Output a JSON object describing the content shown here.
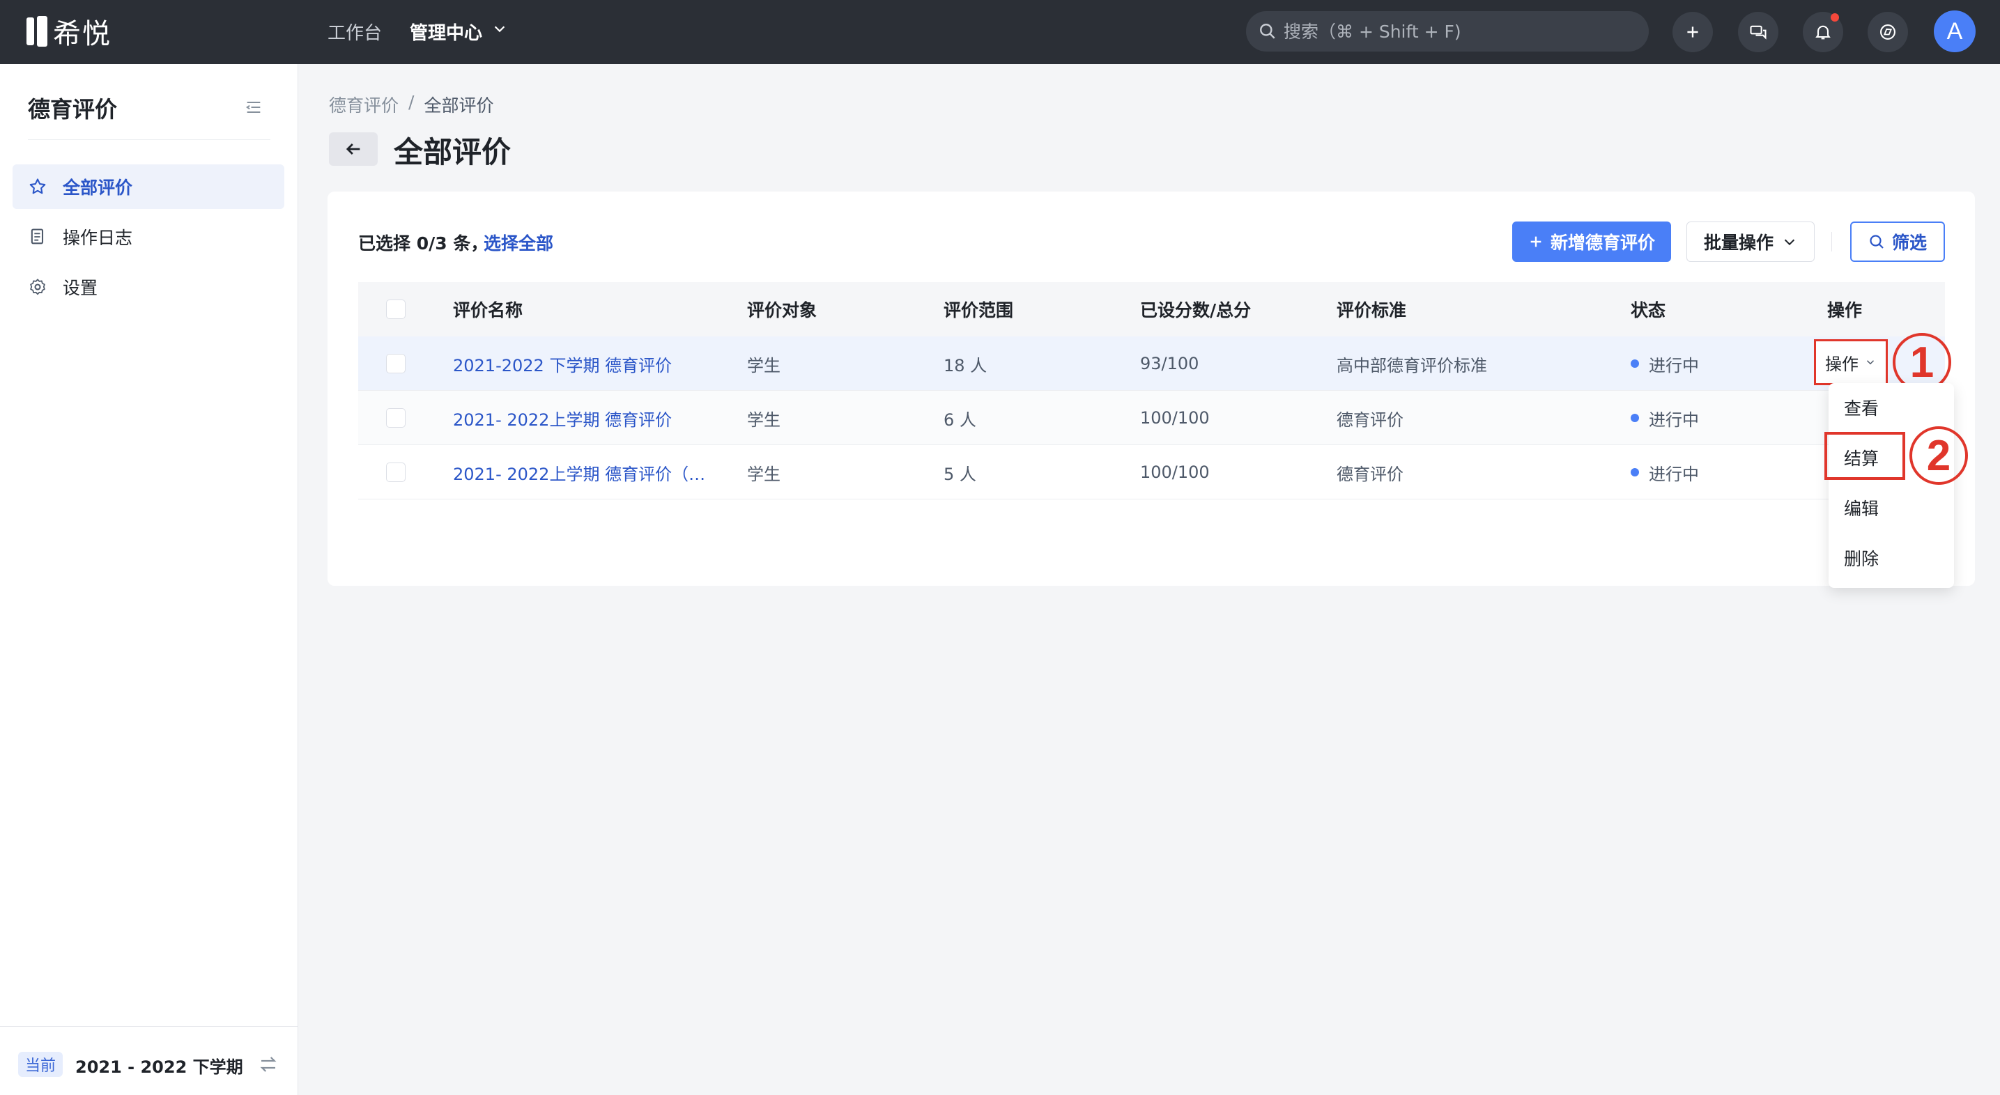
{
  "app": {
    "logo_text": "希悦",
    "nav": {
      "workspace": "工作台",
      "admin": "管理中心"
    },
    "search_placeholder": "搜索（⌘ + Shift + F)",
    "avatar_letter": "A"
  },
  "sidebar": {
    "title": "德育评价",
    "items": [
      {
        "label": "全部评价",
        "icon": "star-icon",
        "active": true
      },
      {
        "label": "操作日志",
        "icon": "document-icon",
        "active": false
      },
      {
        "label": "设置",
        "icon": "gear-icon",
        "active": false
      }
    ],
    "footer": {
      "badge": "当前",
      "term": "2021 - 2022 下学期"
    }
  },
  "breadcrumb": {
    "parent": "德育评价",
    "sep": "/",
    "current": "全部评价"
  },
  "page": {
    "title": "全部评价"
  },
  "toolbar": {
    "selection_info": "已选择 0/3 条，",
    "select_all": "选择全部",
    "add_button": "新增德育评价",
    "batch_button": "批量操作",
    "filter_button": "筛选"
  },
  "table": {
    "headers": [
      "评价名称",
      "评价对象",
      "评价范围",
      "已设分数/总分",
      "评价标准",
      "状态",
      "操作"
    ],
    "rows": [
      {
        "name": "2021-2022 下学期 德育评价",
        "target": "学生",
        "scope": "18 人",
        "score": "93/100",
        "standard": "高中部德育评价标准",
        "status": "进行中"
      },
      {
        "name": "2021- 2022上学期 德育评价",
        "target": "学生",
        "scope": "6 人",
        "score": "100/100",
        "standard": "德育评价",
        "status": "进行中"
      },
      {
        "name": "2021- 2022上学期 德育评价（…",
        "target": "学生",
        "scope": "5 人",
        "score": "100/100",
        "standard": "德育评价",
        "status": "进行中"
      }
    ],
    "row_action_label": "操作"
  },
  "dropdown": {
    "items": [
      "查看",
      "结算",
      "编辑",
      "删除"
    ]
  },
  "annotations": {
    "step1": "1",
    "step2": "2"
  },
  "colors": {
    "accent": "#4a7ff7",
    "link": "#2b56c8",
    "topbar": "#2b2f36",
    "highlight": "#e0362b"
  }
}
